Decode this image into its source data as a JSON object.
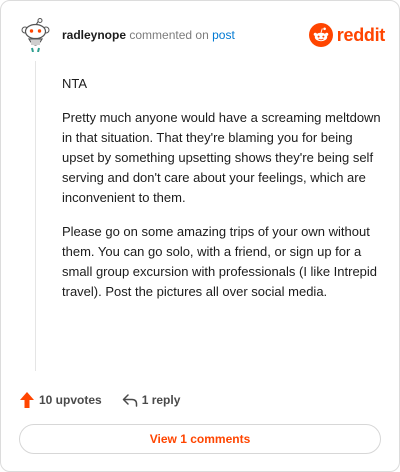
{
  "header": {
    "username": "radleynope",
    "action_text": "commented on",
    "post_link": "post",
    "brand_name": "reddit",
    "avatar_icon": "snoo-avatar-icon",
    "brand_icon": "reddit-snoo-icon"
  },
  "comment": {
    "paragraphs": [
      "NTA",
      "Pretty much anyone would have a screaming meltdown in that situation. That they're blaming you for being upset by something upsetting shows they're being self serving and don't care about your feelings, which are inconvenient to them.",
      "Please go on some amazing trips of your own without them. You can go solo, with a friend, or sign up for a small group excursion with professionals (I like Intrepid travel). Post the pictures all over social media."
    ]
  },
  "actions": {
    "upvotes": "10 upvotes",
    "replies": "1 reply",
    "upvote_icon": "upvote-arrow-icon",
    "reply_icon": "reply-arrow-icon"
  },
  "footer": {
    "view_comments": "View 1 comments"
  },
  "colors": {
    "brand": "#ff4500",
    "link": "#0079d3",
    "muted": "#7c7c7c"
  }
}
